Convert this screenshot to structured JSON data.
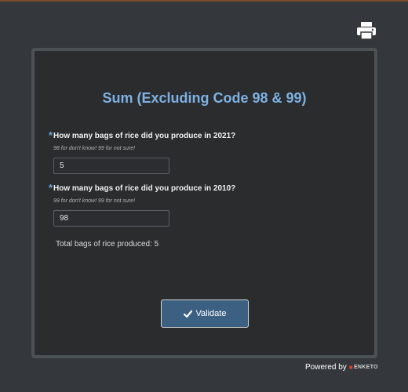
{
  "form": {
    "title": "Sum (Excluding Code 98 & 99)",
    "questions": [
      {
        "required_marker": "*",
        "label": "How many bags of rice did you produce in 2021?",
        "hint": "98 for don't know! 99 for not sure!",
        "value": "5"
      },
      {
        "required_marker": "*",
        "label": "How many bags of rice did you produce in 2010?",
        "hint": "99 for don't know! 99 for not sure!",
        "value": "98"
      }
    ],
    "total_text": "Total bags of rice produced: 5",
    "validate_label": "Validate"
  },
  "footer": {
    "powered_by": "Powered by",
    "logo_text": "ENKETO"
  },
  "icons": {
    "print": "print-icon",
    "validate": "check-icon"
  },
  "colors": {
    "background": "#34383c",
    "panel": "#2b2c2e",
    "title": "#7db1e3",
    "button": "#3b6082"
  }
}
